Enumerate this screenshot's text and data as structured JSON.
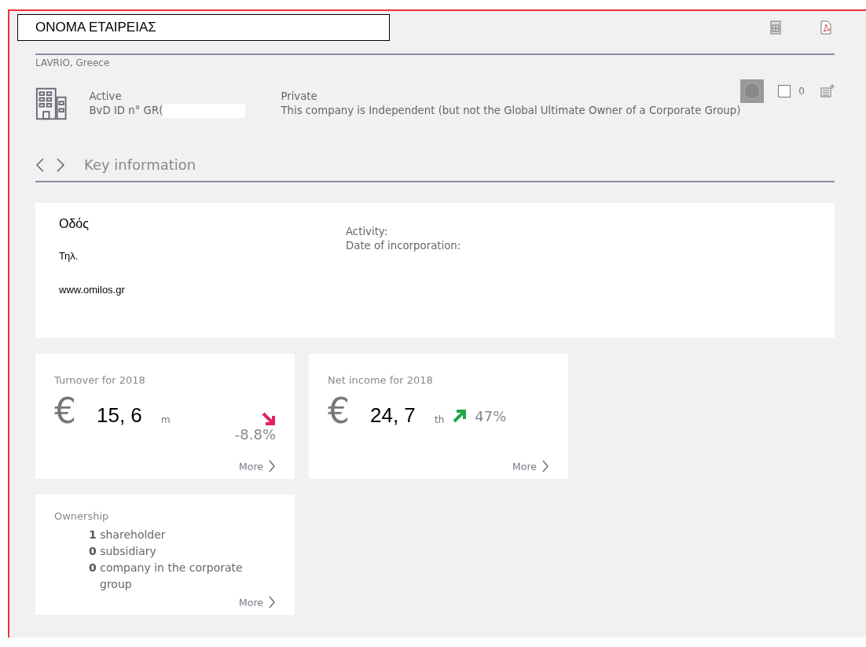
{
  "header": {
    "company_name": "ΟΝΟΜΑ ΕΤΑΙΡΕΙΑΣ",
    "location": "LAVRIO, Greece",
    "status": "Active",
    "bvd_id": "BvD ID n° GR(",
    "type": "Private",
    "independence": "This company is Independent (but not the Global Ultimate Owner of a Corporate Group)",
    "selection_count": "0",
    "selected": false
  },
  "section": {
    "title": "Key information"
  },
  "info": {
    "address": "Οδός",
    "phone": "Τηλ.",
    "website": "www.omilos.gr",
    "labels": [
      "Activity:",
      "Date of incorporation:"
    ]
  },
  "metrics": [
    {
      "title": "Turnover for 2018",
      "currency": "€",
      "value": "15, 6",
      "unit": "m",
      "kind": "down",
      "change": "-8.8%",
      "more": "More"
    },
    {
      "title": "Net income for 2018",
      "currency": "€",
      "value": "24, 7",
      "unit": "th",
      "kind": "up",
      "change": "47%",
      "more": "More"
    }
  ],
  "ownership": {
    "title": "Ownership",
    "items": [
      "**1** shareholder",
      "**0** subsidiary",
      "**0** company in the corporate group"
    ],
    "more": "More"
  }
}
